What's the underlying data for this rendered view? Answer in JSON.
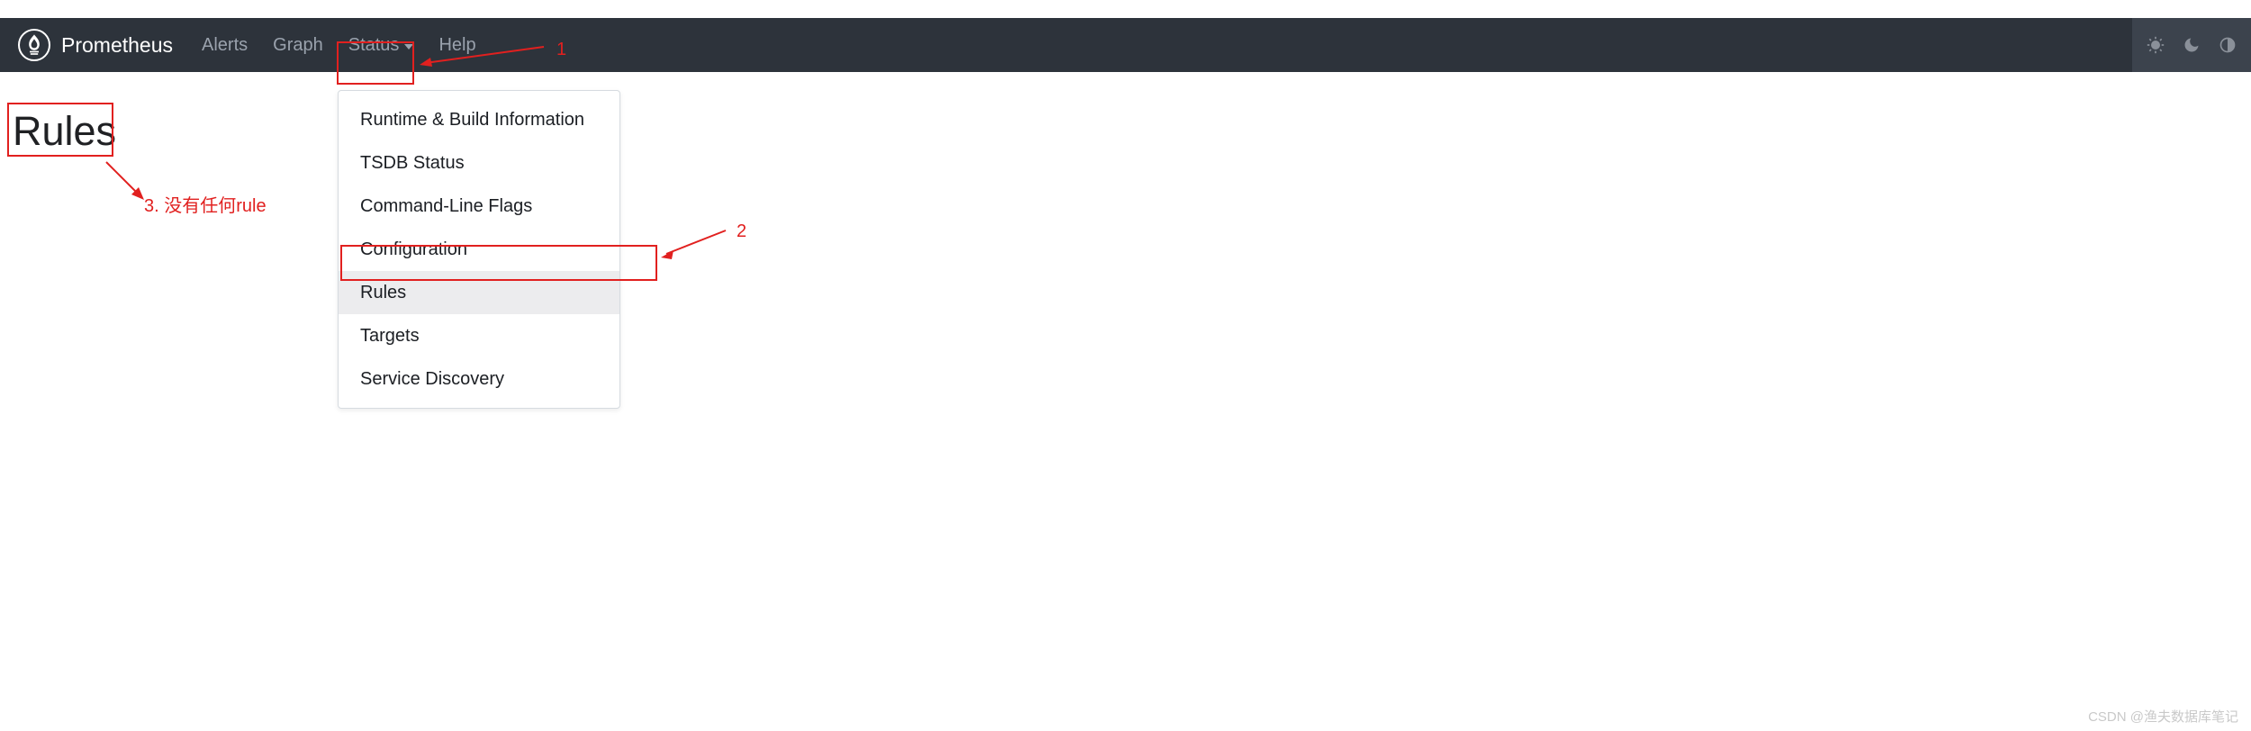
{
  "brand": "Prometheus",
  "nav": {
    "alerts": "Alerts",
    "graph": "Graph",
    "status": "Status",
    "help": "Help"
  },
  "dropdown": {
    "items": [
      {
        "label": "Runtime & Build Information"
      },
      {
        "label": "TSDB Status"
      },
      {
        "label": "Command-Line Flags"
      },
      {
        "label": "Configuration"
      },
      {
        "label": "Rules"
      },
      {
        "label": "Targets"
      },
      {
        "label": "Service Discovery"
      }
    ],
    "active_index": 4
  },
  "page": {
    "title": "Rules"
  },
  "annotations": {
    "a1": "1",
    "a2": "2",
    "a3": "3. 没有任何rule"
  },
  "watermark": "CSDN @渔夫数据库笔记"
}
